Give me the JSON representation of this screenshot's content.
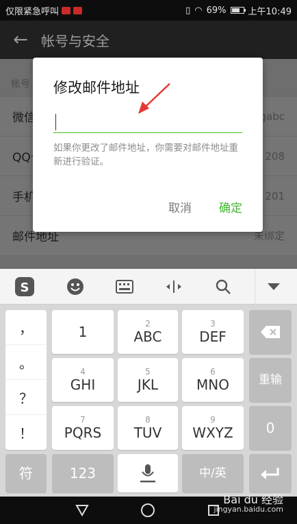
{
  "status": {
    "carrier": "仅限紧急呼叫",
    "battery": "69%",
    "battery_level": 0.69,
    "time": "上午10:49"
  },
  "appbar": {
    "title": "帐号与安全"
  },
  "page": {
    "section_label": "帐号",
    "rows": [
      {
        "label": "微信",
        "value": "gabc"
      },
      {
        "label": "QQ号",
        "value": "208"
      },
      {
        "label": "手机号",
        "value": "201"
      },
      {
        "label": "邮件地址",
        "value": "未绑定"
      }
    ]
  },
  "dialog": {
    "title": "修改邮件地址",
    "input_value": "",
    "description": "如果你更改了邮件地址，你需要对邮件地址重新进行验证。",
    "cancel_label": "取消",
    "ok_label": "确定"
  },
  "keyboard": {
    "toolbar_icons": [
      "sogou-logo-icon",
      "emoji-icon",
      "keyboard-icon",
      "cursor-icon",
      "search-icon",
      "hide-keyboard-icon"
    ],
    "punctuation": [
      "，",
      "。",
      "？",
      "！"
    ],
    "rows": [
      [
        {
          "num": "",
          "label": "1"
        },
        {
          "num": "2",
          "label": "ABC"
        },
        {
          "num": "3",
          "label": "DEF"
        }
      ],
      [
        {
          "num": "4",
          "label": "GHI"
        },
        {
          "num": "5",
          "label": "JKL"
        },
        {
          "num": "6",
          "label": "MNO"
        }
      ],
      [
        {
          "num": "7",
          "label": "PQRS"
        },
        {
          "num": "8",
          "label": "TUV"
        },
        {
          "num": "9",
          "label": "WXYZ"
        }
      ]
    ],
    "reinput_label": "重输",
    "zero_label": "0",
    "symbol_label": "符",
    "num_label": "123",
    "lang_label": "中/英",
    "accent_color": "#3fb72c"
  },
  "watermark": {
    "line1": "Bai du 经验",
    "line2": "jingyan.baidu.com"
  }
}
